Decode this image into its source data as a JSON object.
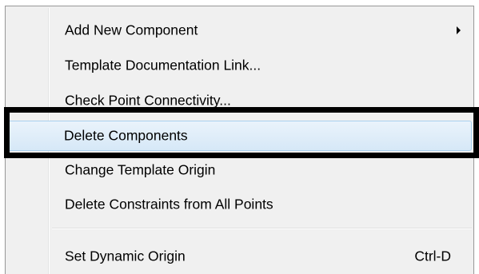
{
  "context_menu": {
    "items": [
      {
        "label": "Add New Component",
        "has_submenu": true
      },
      {
        "label": "Template Documentation Link..."
      },
      {
        "label": "Check Point Connectivity..."
      },
      {
        "label": "Delete Components",
        "highlighted": true
      },
      {
        "label": "Change Template Origin"
      },
      {
        "label": "Delete Constraints from All Points"
      },
      {
        "label": "Set Dynamic Origin",
        "shortcut": "Ctrl-D"
      }
    ]
  },
  "colors": {
    "menu_background": "#f0f0f0",
    "highlight_background": "#dbeaf8",
    "highlight_border": "#a8d0ee",
    "focus_frame": "#000000"
  }
}
